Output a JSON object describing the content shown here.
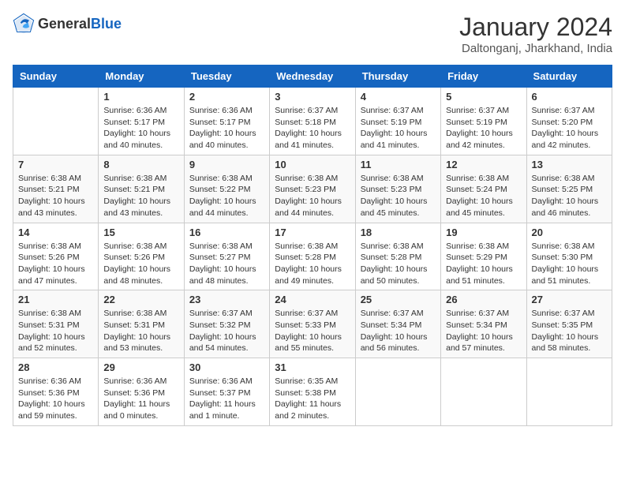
{
  "header": {
    "logo_general": "General",
    "logo_blue": "Blue",
    "month_title": "January 2024",
    "location": "Daltonganj, Jharkhand, India"
  },
  "days_of_week": [
    "Sunday",
    "Monday",
    "Tuesday",
    "Wednesday",
    "Thursday",
    "Friday",
    "Saturday"
  ],
  "weeks": [
    [
      {
        "day": "",
        "sunrise": "",
        "sunset": "",
        "daylight": ""
      },
      {
        "day": "1",
        "sunrise": "Sunrise: 6:36 AM",
        "sunset": "Sunset: 5:17 PM",
        "daylight": "Daylight: 10 hours and 40 minutes."
      },
      {
        "day": "2",
        "sunrise": "Sunrise: 6:36 AM",
        "sunset": "Sunset: 5:17 PM",
        "daylight": "Daylight: 10 hours and 40 minutes."
      },
      {
        "day": "3",
        "sunrise": "Sunrise: 6:37 AM",
        "sunset": "Sunset: 5:18 PM",
        "daylight": "Daylight: 10 hours and 41 minutes."
      },
      {
        "day": "4",
        "sunrise": "Sunrise: 6:37 AM",
        "sunset": "Sunset: 5:19 PM",
        "daylight": "Daylight: 10 hours and 41 minutes."
      },
      {
        "day": "5",
        "sunrise": "Sunrise: 6:37 AM",
        "sunset": "Sunset: 5:19 PM",
        "daylight": "Daylight: 10 hours and 42 minutes."
      },
      {
        "day": "6",
        "sunrise": "Sunrise: 6:37 AM",
        "sunset": "Sunset: 5:20 PM",
        "daylight": "Daylight: 10 hours and 42 minutes."
      }
    ],
    [
      {
        "day": "7",
        "sunrise": "Sunrise: 6:38 AM",
        "sunset": "Sunset: 5:21 PM",
        "daylight": "Daylight: 10 hours and 43 minutes."
      },
      {
        "day": "8",
        "sunrise": "Sunrise: 6:38 AM",
        "sunset": "Sunset: 5:21 PM",
        "daylight": "Daylight: 10 hours and 43 minutes."
      },
      {
        "day": "9",
        "sunrise": "Sunrise: 6:38 AM",
        "sunset": "Sunset: 5:22 PM",
        "daylight": "Daylight: 10 hours and 44 minutes."
      },
      {
        "day": "10",
        "sunrise": "Sunrise: 6:38 AM",
        "sunset": "Sunset: 5:23 PM",
        "daylight": "Daylight: 10 hours and 44 minutes."
      },
      {
        "day": "11",
        "sunrise": "Sunrise: 6:38 AM",
        "sunset": "Sunset: 5:23 PM",
        "daylight": "Daylight: 10 hours and 45 minutes."
      },
      {
        "day": "12",
        "sunrise": "Sunrise: 6:38 AM",
        "sunset": "Sunset: 5:24 PM",
        "daylight": "Daylight: 10 hours and 45 minutes."
      },
      {
        "day": "13",
        "sunrise": "Sunrise: 6:38 AM",
        "sunset": "Sunset: 5:25 PM",
        "daylight": "Daylight: 10 hours and 46 minutes."
      }
    ],
    [
      {
        "day": "14",
        "sunrise": "Sunrise: 6:38 AM",
        "sunset": "Sunset: 5:26 PM",
        "daylight": "Daylight: 10 hours and 47 minutes."
      },
      {
        "day": "15",
        "sunrise": "Sunrise: 6:38 AM",
        "sunset": "Sunset: 5:26 PM",
        "daylight": "Daylight: 10 hours and 48 minutes."
      },
      {
        "day": "16",
        "sunrise": "Sunrise: 6:38 AM",
        "sunset": "Sunset: 5:27 PM",
        "daylight": "Daylight: 10 hours and 48 minutes."
      },
      {
        "day": "17",
        "sunrise": "Sunrise: 6:38 AM",
        "sunset": "Sunset: 5:28 PM",
        "daylight": "Daylight: 10 hours and 49 minutes."
      },
      {
        "day": "18",
        "sunrise": "Sunrise: 6:38 AM",
        "sunset": "Sunset: 5:28 PM",
        "daylight": "Daylight: 10 hours and 50 minutes."
      },
      {
        "day": "19",
        "sunrise": "Sunrise: 6:38 AM",
        "sunset": "Sunset: 5:29 PM",
        "daylight": "Daylight: 10 hours and 51 minutes."
      },
      {
        "day": "20",
        "sunrise": "Sunrise: 6:38 AM",
        "sunset": "Sunset: 5:30 PM",
        "daylight": "Daylight: 10 hours and 51 minutes."
      }
    ],
    [
      {
        "day": "21",
        "sunrise": "Sunrise: 6:38 AM",
        "sunset": "Sunset: 5:31 PM",
        "daylight": "Daylight: 10 hours and 52 minutes."
      },
      {
        "day": "22",
        "sunrise": "Sunrise: 6:38 AM",
        "sunset": "Sunset: 5:31 PM",
        "daylight": "Daylight: 10 hours and 53 minutes."
      },
      {
        "day": "23",
        "sunrise": "Sunrise: 6:37 AM",
        "sunset": "Sunset: 5:32 PM",
        "daylight": "Daylight: 10 hours and 54 minutes."
      },
      {
        "day": "24",
        "sunrise": "Sunrise: 6:37 AM",
        "sunset": "Sunset: 5:33 PM",
        "daylight": "Daylight: 10 hours and 55 minutes."
      },
      {
        "day": "25",
        "sunrise": "Sunrise: 6:37 AM",
        "sunset": "Sunset: 5:34 PM",
        "daylight": "Daylight: 10 hours and 56 minutes."
      },
      {
        "day": "26",
        "sunrise": "Sunrise: 6:37 AM",
        "sunset": "Sunset: 5:34 PM",
        "daylight": "Daylight: 10 hours and 57 minutes."
      },
      {
        "day": "27",
        "sunrise": "Sunrise: 6:37 AM",
        "sunset": "Sunset: 5:35 PM",
        "daylight": "Daylight: 10 hours and 58 minutes."
      }
    ],
    [
      {
        "day": "28",
        "sunrise": "Sunrise: 6:36 AM",
        "sunset": "Sunset: 5:36 PM",
        "daylight": "Daylight: 10 hours and 59 minutes."
      },
      {
        "day": "29",
        "sunrise": "Sunrise: 6:36 AM",
        "sunset": "Sunset: 5:36 PM",
        "daylight": "Daylight: 11 hours and 0 minutes."
      },
      {
        "day": "30",
        "sunrise": "Sunrise: 6:36 AM",
        "sunset": "Sunset: 5:37 PM",
        "daylight": "Daylight: 11 hours and 1 minute."
      },
      {
        "day": "31",
        "sunrise": "Sunrise: 6:35 AM",
        "sunset": "Sunset: 5:38 PM",
        "daylight": "Daylight: 11 hours and 2 minutes."
      },
      {
        "day": "",
        "sunrise": "",
        "sunset": "",
        "daylight": ""
      },
      {
        "day": "",
        "sunrise": "",
        "sunset": "",
        "daylight": ""
      },
      {
        "day": "",
        "sunrise": "",
        "sunset": "",
        "daylight": ""
      }
    ]
  ]
}
